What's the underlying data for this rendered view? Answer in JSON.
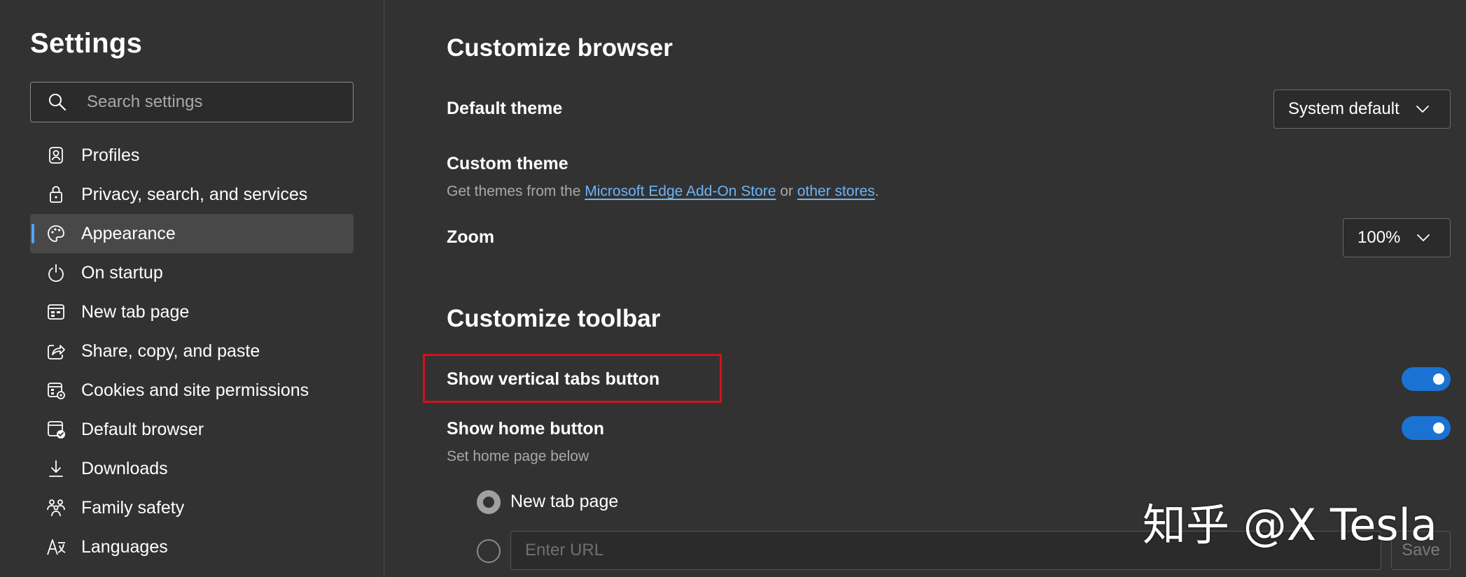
{
  "sidebar": {
    "title": "Settings",
    "search_placeholder": "Search settings",
    "items": [
      {
        "label": "Profiles",
        "icon": "profile-icon"
      },
      {
        "label": "Privacy, search, and services",
        "icon": "lock-icon"
      },
      {
        "label": "Appearance",
        "icon": "palette-icon",
        "active": true
      },
      {
        "label": "On startup",
        "icon": "power-icon"
      },
      {
        "label": "New tab page",
        "icon": "new-tab-icon"
      },
      {
        "label": "Share, copy, and paste",
        "icon": "share-icon"
      },
      {
        "label": "Cookies and site permissions",
        "icon": "cookies-icon"
      },
      {
        "label": "Default browser",
        "icon": "default-browser-icon"
      },
      {
        "label": "Downloads",
        "icon": "download-icon"
      },
      {
        "label": "Family safety",
        "icon": "family-icon"
      },
      {
        "label": "Languages",
        "icon": "languages-icon"
      }
    ]
  },
  "main": {
    "customize_browser": {
      "title": "Customize browser",
      "default_theme": {
        "label": "Default theme",
        "value": "System default"
      },
      "custom_theme": {
        "label": "Custom theme",
        "desc_prefix": "Get themes from the ",
        "link1": "Microsoft Edge Add-On Store",
        "desc_mid": " or ",
        "link2": "other stores",
        "desc_suffix": "."
      },
      "zoom": {
        "label": "Zoom",
        "value": "100%"
      }
    },
    "customize_toolbar": {
      "title": "Customize toolbar",
      "vertical_tabs": {
        "label": "Show vertical tabs button",
        "enabled": true
      },
      "home_button": {
        "label": "Show home button",
        "desc": "Set home page below",
        "enabled": true
      },
      "home_options": {
        "new_tab_label": "New tab page",
        "url_placeholder": "Enter URL",
        "save_label": "Save"
      }
    }
  },
  "watermark": "知乎 @X Tesla",
  "colors": {
    "background": "#323232",
    "accent": "#1a73d2",
    "link": "#6cb4f7",
    "highlight": "#d0131b"
  }
}
